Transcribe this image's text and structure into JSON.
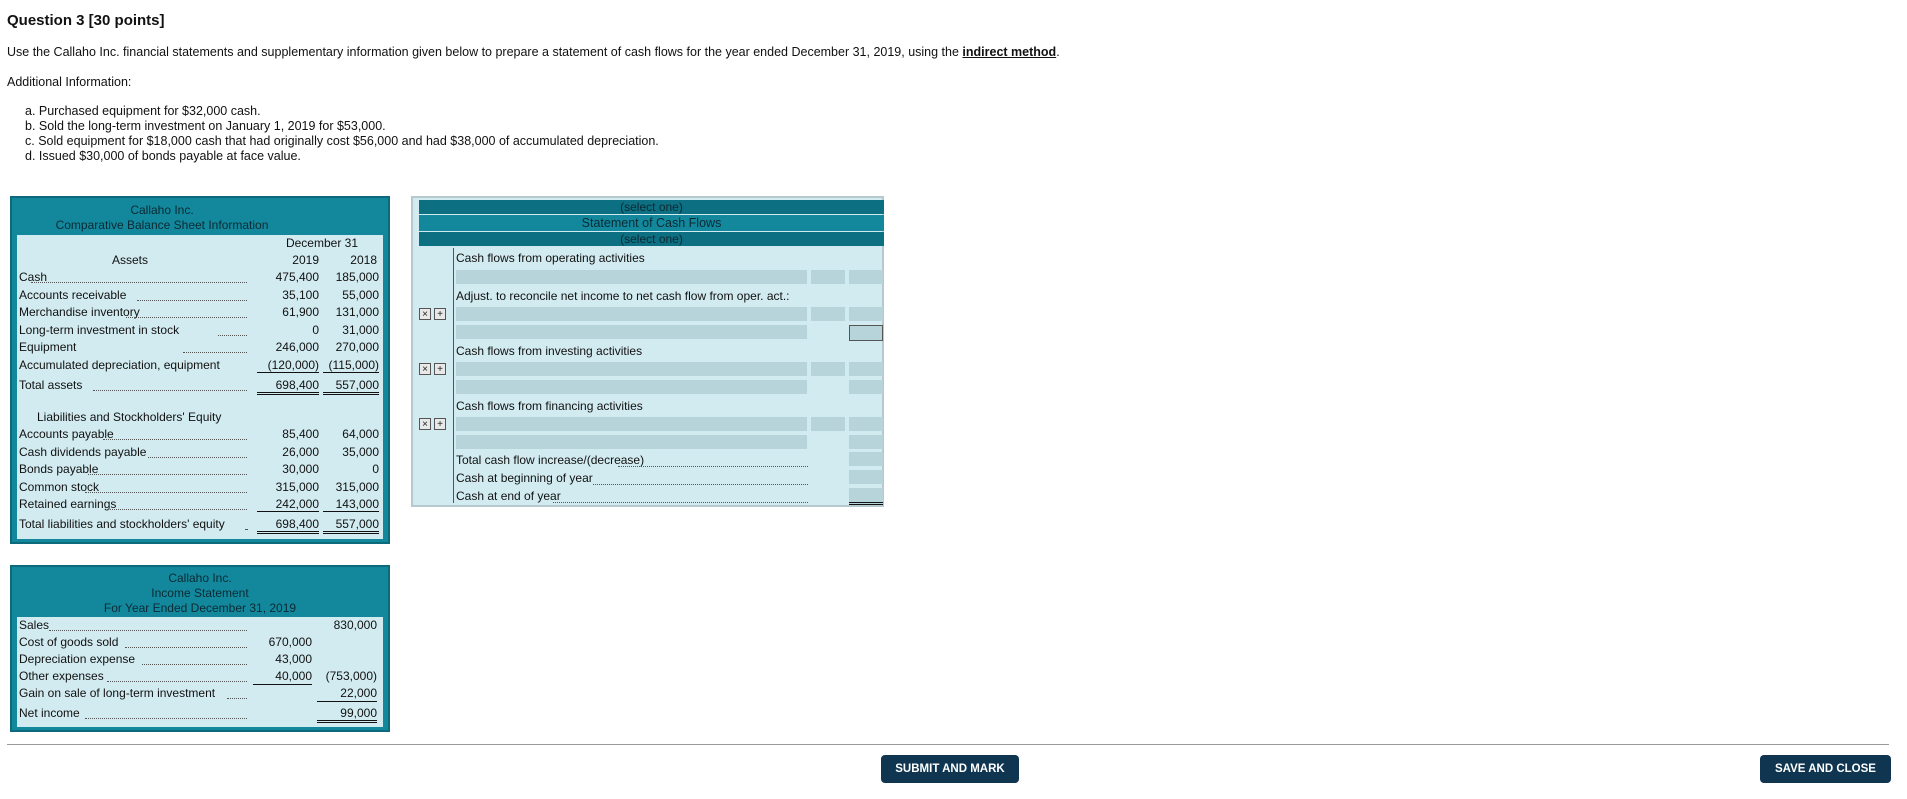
{
  "question_title": "Question 3 [30 points]",
  "instructions": {
    "prefix": "Use the Callaho Inc. financial statements and supplementary information given below to prepare a statement of cash flows for the year ended December 31, 2019, using the ",
    "method": "indirect method",
    "suffix": "."
  },
  "additional_label": "Additional Information:",
  "additional_items": [
    "a. Purchased equipment for $32,000 cash.",
    "b. Sold the long-term investment on January 1, 2019 for $53,000.",
    "c. Sold equipment for $18,000 cash that had originally cost $56,000 and had $38,000 of accumulated depreciation.",
    "d. Issued $30,000 of bonds payable at face value."
  ],
  "balance_sheet": {
    "company": "Callaho Inc.",
    "title": "Comparative Balance Sheet Information",
    "period": "December 31",
    "assets_heading": "Assets",
    "year1": "2019",
    "year2": "2018",
    "assets": [
      {
        "label": "Cash",
        "y2019": "475,400",
        "y2018": "185,000"
      },
      {
        "label": "Accounts receivable",
        "y2019": "35,100",
        "y2018": "55,000"
      },
      {
        "label": "Merchandise inventory",
        "y2019": "61,900",
        "y2018": "131,000"
      },
      {
        "label": "Long-term investment in stock",
        "y2019": "0",
        "y2018": "31,000"
      },
      {
        "label": "Equipment",
        "y2019": "246,000",
        "y2018": "270,000"
      },
      {
        "label": "Accumulated depreciation, equipment",
        "y2019": "(120,000)",
        "y2018": "(115,000)"
      }
    ],
    "total_assets": {
      "label": "Total assets",
      "y2019": "698,400",
      "y2018": "557,000"
    },
    "liab_heading": "Liabilities and Stockholders' Equity",
    "liabilities": [
      {
        "label": "Accounts payable",
        "y2019": "85,400",
        "y2018": "64,000"
      },
      {
        "label": "Cash dividends payable",
        "y2019": "26,000",
        "y2018": "35,000"
      },
      {
        "label": "Bonds payable",
        "y2019": "30,000",
        "y2018": "0"
      },
      {
        "label": "Common stock",
        "y2019": "315,000",
        "y2018": "315,000"
      },
      {
        "label": "Retained earnings",
        "y2019": "242,000",
        "y2018": "143,000"
      }
    ],
    "total_liab": {
      "label": "Total liabilities and stockholders' equity",
      "y2019": "698,400",
      "y2018": "557,000"
    }
  },
  "income_statement": {
    "company": "Callaho Inc.",
    "title": "Income Statement",
    "period": "For Year Ended December 31, 2019",
    "sales": {
      "label": "Sales",
      "value": "830,000"
    },
    "cogs": {
      "label": "Cost of goods sold",
      "value": "670,000"
    },
    "dep": {
      "label": "Depreciation expense",
      "value": "43,000"
    },
    "other": {
      "label": "Other expenses",
      "value": "40,000",
      "total": "(753,000)"
    },
    "gain": {
      "label": "Gain on sale of long-term investment",
      "value": "22,000"
    },
    "net": {
      "label": "Net income",
      "value": "99,000"
    }
  },
  "cash_flow": {
    "select_top": "(select one)",
    "title": "Statement of Cash Flows",
    "select_bottom": "(select one)",
    "operating": "Cash flows from operating activities",
    "adjust": "Adjust. to reconcile net income to net cash flow from oper. act.:",
    "investing": "Cash flows from investing activities",
    "financing": "Cash flows from financing activities",
    "total_change": "Total cash flow increase/(decrease)",
    "cash_begin": "Cash at beginning of year",
    "cash_end": "Cash at end of year"
  },
  "icons": {
    "delete": "×",
    "insert": "+"
  },
  "buttons": {
    "submit": "SUBMIT AND MARK",
    "save": "SAVE AND CLOSE"
  }
}
